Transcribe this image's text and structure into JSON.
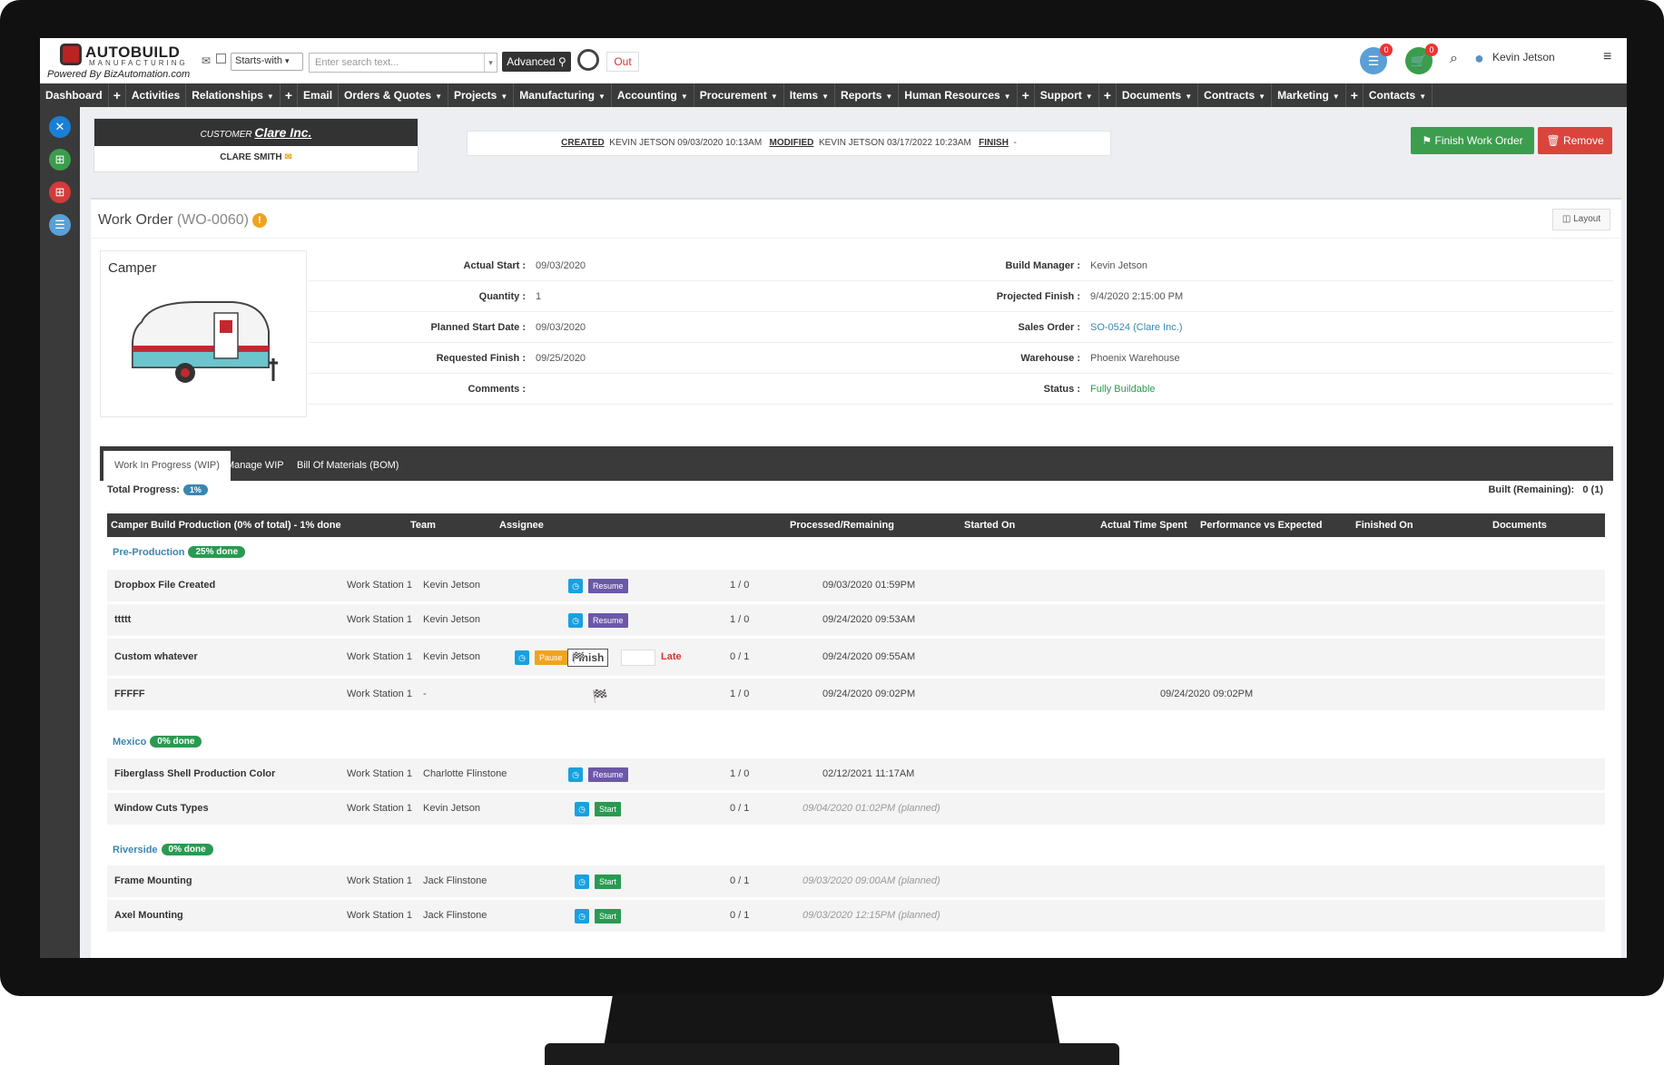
{
  "brand": {
    "name": "AUTOBUILD",
    "sub": "MANUFACTURING",
    "powered": "Powered By BizAutomation.com"
  },
  "search": {
    "mode": "Starts-with",
    "placeholder": "Enter search text...",
    "advanced": "Advanced",
    "out": "Out"
  },
  "header": {
    "badge_count_1": "0",
    "badge_count_2": "0",
    "user": "Kevin Jetson"
  },
  "nav": [
    "Dashboard",
    "Activities",
    "Relationships",
    "Email",
    "Orders & Quotes",
    "Projects",
    "Manufacturing",
    "Accounting",
    "Procurement",
    "Items",
    "Reports",
    "Human Resources",
    "Support",
    "Documents",
    "Contracts",
    "Marketing",
    "Contacts"
  ],
  "customer": {
    "label": "CUSTOMER",
    "name": "Clare Inc.",
    "contact": "CLARE SMITH"
  },
  "meta": {
    "created_label": "CREATED",
    "created": "KEVIN JETSON 09/03/2020 10:13AM",
    "modified_label": "MODIFIED",
    "modified": "KEVIN JETSON 03/17/2022 10:23AM",
    "finish_label": "FINISH",
    "finish": "-"
  },
  "actions": {
    "finish": "Finish Work Order",
    "remove": "Remove"
  },
  "wo": {
    "title": "Work Order",
    "id": "(WO-0060)",
    "layout": "Layout",
    "product": "Camper"
  },
  "fields_left": [
    {
      "label": "Actual Start :",
      "value": "09/03/2020"
    },
    {
      "label": "Quantity :",
      "value": "1"
    },
    {
      "label": "Planned Start Date :",
      "value": "09/03/2020"
    },
    {
      "label": "Requested Finish :",
      "value": "09/25/2020"
    },
    {
      "label": "Comments :",
      "value": ""
    }
  ],
  "fields_right": [
    {
      "label": "Build Manager :",
      "value": "Kevin Jetson"
    },
    {
      "label": "Projected Finish :",
      "value": "9/4/2020 2:15:00 PM"
    },
    {
      "label": "Sales Order :",
      "value": "SO-0524 (Clare Inc.)"
    },
    {
      "label": "Warehouse :",
      "value": "Phoenix Warehouse"
    },
    {
      "label": "Status :",
      "value": "Fully Buildable"
    }
  ],
  "tabs": [
    "Work In Progress (WIP)",
    "Manage WIP",
    "Bill Of Materials (BOM)"
  ],
  "progress": {
    "label": "Total Progress:",
    "value": "1%",
    "built_label": "Built (Remaining):",
    "built": "0 (1)"
  },
  "table": {
    "headers": [
      "Camper Build Production (0% of total) - 1% done",
      "Team",
      "Assignee",
      "Processed/Remaining",
      "Started On",
      "Actual Time Spent",
      "Performance vs Expected",
      "Finished On",
      "Documents"
    ],
    "groups": [
      {
        "name": "Pre-Production",
        "badge": "25% done"
      },
      {
        "name": "Mexico",
        "badge": "0% done"
      },
      {
        "name": "Riverside",
        "badge": "0% done"
      }
    ],
    "rows": [
      {
        "name": "Dropbox File Created",
        "team": "Work Station 1",
        "assignee": "Kevin Jetson",
        "action": "Resume",
        "pr": "1 / 0",
        "started": "09/03/2020 01:59PM",
        "finished": ""
      },
      {
        "name": "ttttt",
        "team": "Work Station 1",
        "assignee": "Kevin Jetson",
        "action": "Resume",
        "pr": "1 / 0",
        "started": "09/24/2020 09:53AM",
        "finished": ""
      },
      {
        "name": "Custom whatever",
        "team": "Work Station 1",
        "assignee": "Kevin Jetson",
        "action": "Pause",
        "finish": "Finish",
        "late": "Late",
        "pr": "0 / 1",
        "started": "09/24/2020 09:55AM",
        "finished": ""
      },
      {
        "name": "FFFFF",
        "team": "Work Station 1",
        "assignee": "-",
        "action": "",
        "pr": "1 / 0",
        "started": "09/24/2020 09:02PM",
        "finished": "09/24/2020 09:02PM"
      },
      {
        "name": "Fiberglass Shell Production Color",
        "team": "Work Station 1",
        "assignee": "Charlotte Flinstone",
        "action": "Resume",
        "pr": "1 / 0",
        "started": "02/12/2021 11:17AM",
        "finished": ""
      },
      {
        "name": "Window Cuts Types",
        "team": "Work Station 1",
        "assignee": "Kevin Jetson",
        "action": "Start",
        "pr": "0 / 1",
        "started": "09/04/2020 01:02PM (planned)",
        "finished": ""
      },
      {
        "name": "Frame Mounting",
        "team": "Work Station 1",
        "assignee": "Jack Flinstone",
        "action": "Start",
        "pr": "0 / 1",
        "started": "09/03/2020 09:00AM (planned)",
        "finished": ""
      },
      {
        "name": "Axel Mounting",
        "team": "Work Station 1",
        "assignee": "Jack Flinstone",
        "action": "Start",
        "pr": "0 / 1",
        "started": "09/03/2020 12:15PM (planned)",
        "finished": ""
      }
    ]
  }
}
